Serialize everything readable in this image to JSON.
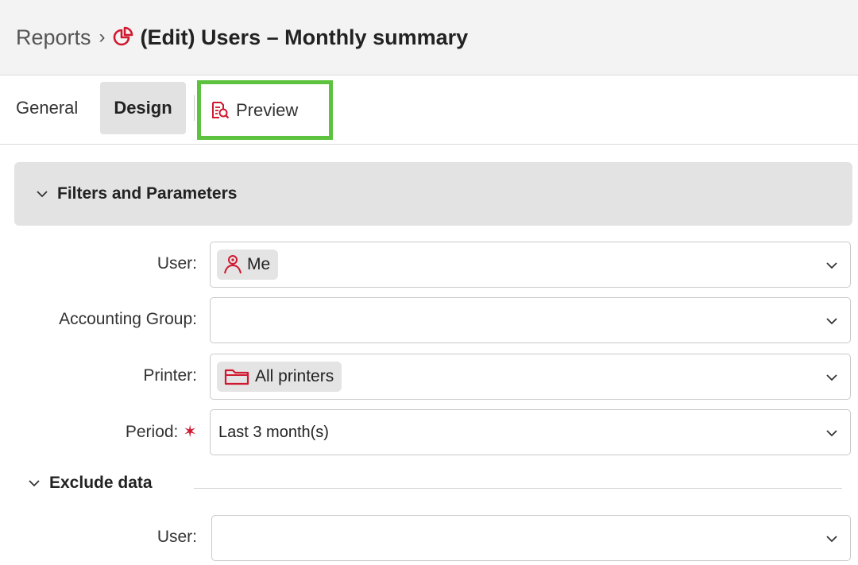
{
  "breadcrumb": {
    "root": "Reports",
    "separator": "›",
    "title": "(Edit) Users – Monthly summary",
    "icon": "pie-chart-icon"
  },
  "tabs": [
    {
      "label": "General",
      "active": false
    },
    {
      "label": "Design",
      "active": true
    },
    {
      "label": "Preview",
      "active": false,
      "icon": "preview-doc-icon",
      "highlighted": true
    }
  ],
  "filters_section": {
    "title": "Filters and Parameters",
    "fields": [
      {
        "label": "User:",
        "chip": "Me",
        "chip_icon": "user-icon"
      },
      {
        "label": "Accounting Group:",
        "value": ""
      },
      {
        "label": "Printer:",
        "chip": "All printers",
        "chip_icon": "folder-icon"
      },
      {
        "label": "Period:",
        "required_marker": "✶",
        "value": "Last 3 month(s)"
      }
    ]
  },
  "exclude_section": {
    "title": "Exclude data",
    "fields": [
      {
        "label": "User:",
        "value": ""
      }
    ]
  },
  "colors": {
    "accent_red": "#d0182f",
    "highlight_green": "#5dc23e",
    "header_bg": "#f3f3f3",
    "section_bg": "#e3e3e3"
  }
}
